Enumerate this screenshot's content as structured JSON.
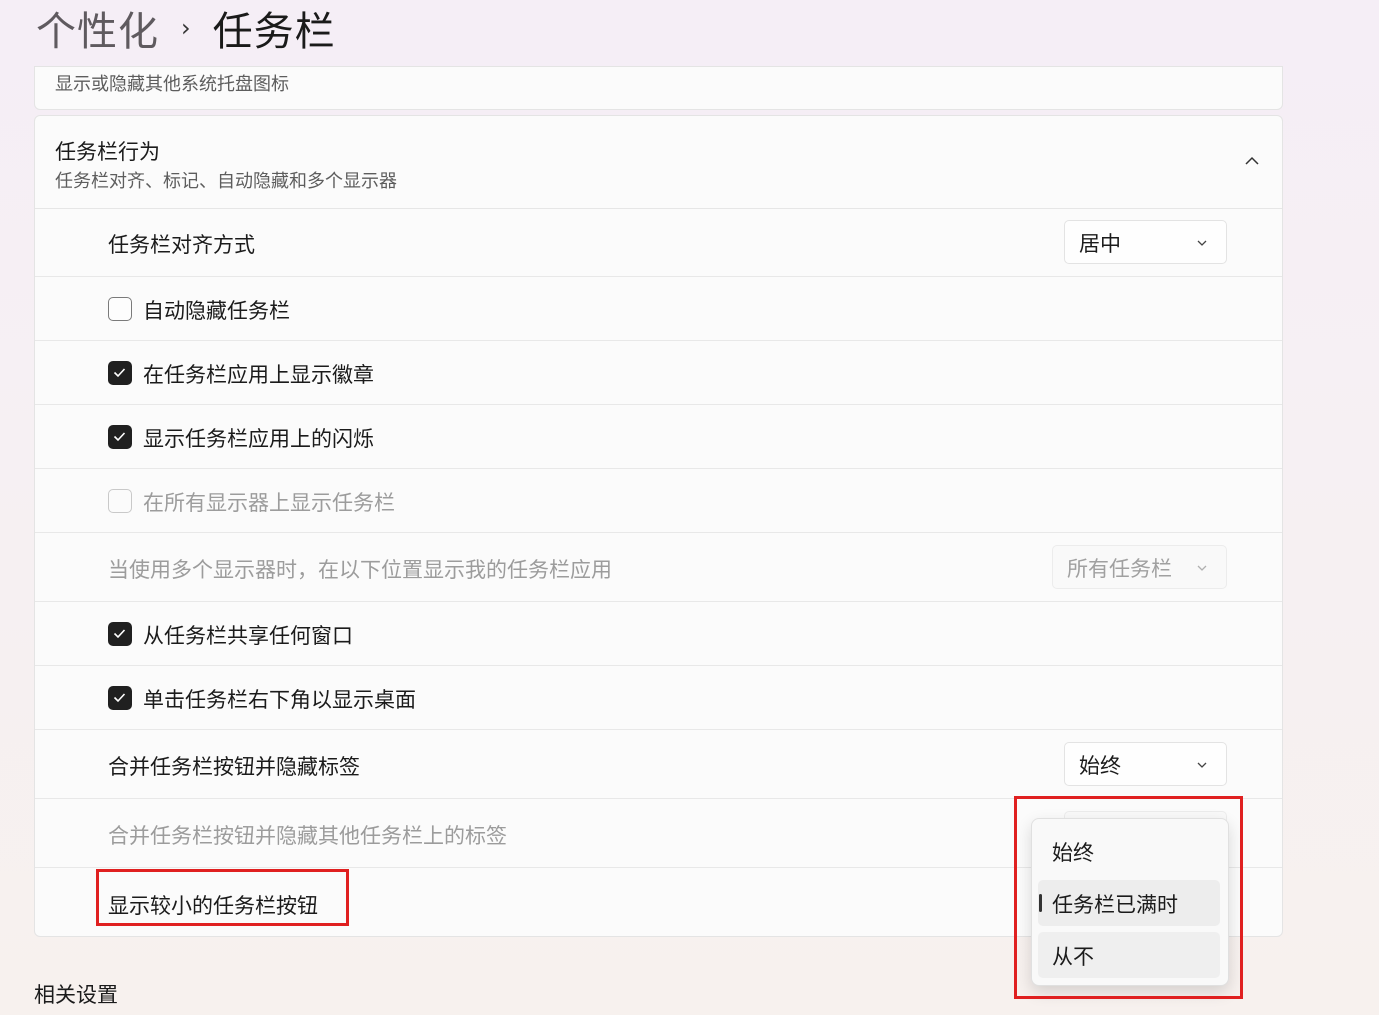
{
  "breadcrumb": {
    "parent": "个性化",
    "separator": "›",
    "current": "任务栏"
  },
  "tray_card": {
    "subtitle": "显示或隐藏其他系统托盘图标"
  },
  "behavior": {
    "title": "任务栏行为",
    "description": "任务栏对齐、标记、自动隐藏和多个显示器",
    "expanded": true,
    "alignment": {
      "label": "任务栏对齐方式",
      "value": "居中"
    },
    "auto_hide": {
      "label": "自动隐藏任务栏",
      "checked": false
    },
    "badges": {
      "label": "在任务栏应用上显示徽章",
      "checked": true
    },
    "flashing": {
      "label": "显示任务栏应用上的闪烁",
      "checked": true
    },
    "all_displays": {
      "label": "在所有显示器上显示任务栏",
      "checked": false,
      "enabled": false
    },
    "multi_display_apps": {
      "label": "当使用多个显示器时，在以下位置显示我的任务栏应用",
      "value": "所有任务栏",
      "enabled": false
    },
    "share_window": {
      "label": "从任务栏共享任何窗口",
      "checked": true
    },
    "far_corner": {
      "label": "单击任务栏右下角以显示桌面",
      "checked": true
    },
    "combine": {
      "label": "合并任务栏按钮并隐藏标签",
      "value": "始终"
    },
    "combine_other": {
      "label": "合并任务栏按钮并隐藏其他任务栏上的标签",
      "enabled": false
    },
    "small_buttons": {
      "label": "显示较小的任务栏按钮"
    }
  },
  "dropdown_menu": {
    "options": [
      "始终",
      "任务栏已满时",
      "从不"
    ],
    "selected_index": 1
  },
  "related": {
    "title": "相关设置"
  },
  "colors": {
    "highlight": "#e02020",
    "checkbox_checked": "#202020"
  }
}
